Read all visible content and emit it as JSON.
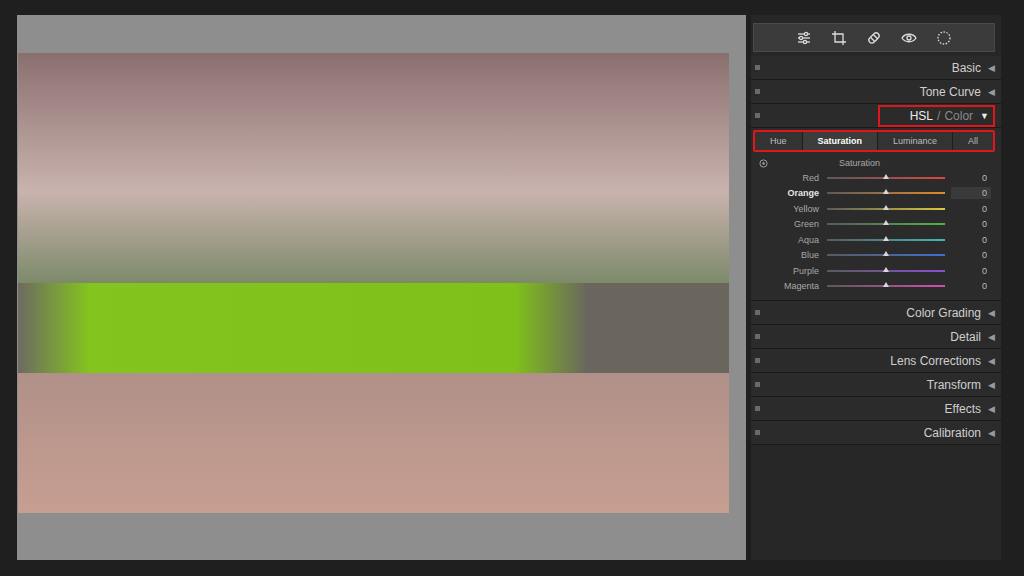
{
  "sections_before": [
    {
      "label": "Basic",
      "expanded": false
    },
    {
      "label": "Tone Curve",
      "expanded": false
    }
  ],
  "hsl": {
    "label": "HSL",
    "separator": "/",
    "alt_label": "Color",
    "expanded": true,
    "annotated": true,
    "tabs": [
      {
        "label": "Hue",
        "selected": false
      },
      {
        "label": "Saturation",
        "selected": true
      },
      {
        "label": "Luminance",
        "selected": false
      },
      {
        "label": "All",
        "selected": false
      }
    ],
    "tabs_annotated": true,
    "group_title": "Saturation",
    "sliders": [
      {
        "name": "Red",
        "value": "0",
        "level": 0.5,
        "color": "#d9473f",
        "selected": false
      },
      {
        "name": "Orange",
        "value": "0",
        "level": 0.5,
        "color": "#e08a2e",
        "selected": true
      },
      {
        "name": "Yellow",
        "value": "0",
        "level": 0.5,
        "color": "#d8c93a",
        "selected": false
      },
      {
        "name": "Green",
        "value": "0",
        "level": 0.5,
        "color": "#4fb24a",
        "selected": false
      },
      {
        "name": "Aqua",
        "value": "0",
        "level": 0.5,
        "color": "#3fb8b8",
        "selected": false
      },
      {
        "name": "Blue",
        "value": "0",
        "level": 0.5,
        "color": "#3f6fd0",
        "selected": false
      },
      {
        "name": "Purple",
        "value": "0",
        "level": 0.5,
        "color": "#8a4fd0",
        "selected": false
      },
      {
        "name": "Magenta",
        "value": "0",
        "level": 0.5,
        "color": "#d04fb0",
        "selected": false
      }
    ]
  },
  "sections_after": [
    {
      "label": "Color Grading",
      "expanded": false
    },
    {
      "label": "Detail",
      "expanded": false
    },
    {
      "label": "Lens Corrections",
      "expanded": false
    },
    {
      "label": "Transform",
      "expanded": false
    },
    {
      "label": "Effects",
      "expanded": false
    },
    {
      "label": "Calibration",
      "expanded": false
    }
  ],
  "icons": {
    "collapsed": "◀",
    "expanded": "▼"
  }
}
